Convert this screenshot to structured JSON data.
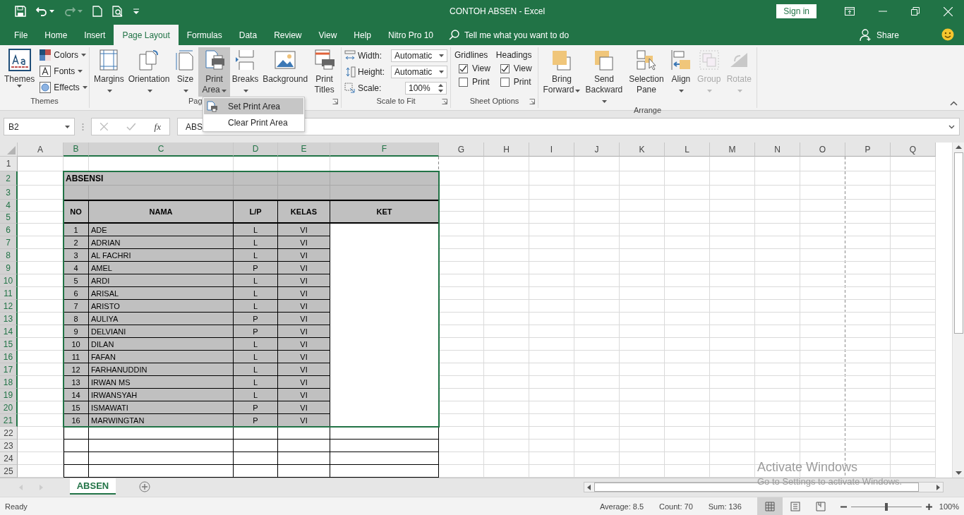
{
  "window": {
    "title": "CONTOH ABSEN  -  Excel",
    "sign_in": "Sign in"
  },
  "menu_tabs": [
    {
      "label": "File",
      "selected": false
    },
    {
      "label": "Home",
      "selected": false
    },
    {
      "label": "Insert",
      "selected": false
    },
    {
      "label": "Page Layout",
      "selected": true
    },
    {
      "label": "Formulas",
      "selected": false
    },
    {
      "label": "Data",
      "selected": false
    },
    {
      "label": "Review",
      "selected": false
    },
    {
      "label": "View",
      "selected": false
    },
    {
      "label": "Help",
      "selected": false
    },
    {
      "label": "Nitro Pro 10",
      "selected": false
    }
  ],
  "tell_me": "Tell me what you want to do",
  "share": "Share",
  "ribbon": {
    "themes": {
      "label": "Themes",
      "big": {
        "label": "Themes",
        "dropdown": true
      },
      "items": [
        {
          "label": "Colors"
        },
        {
          "label": "Fonts"
        },
        {
          "label": "Effects"
        }
      ]
    },
    "page_setup": {
      "label": "Pag",
      "buttons": [
        {
          "label": "Margins",
          "dropdown": true,
          "selected": false
        },
        {
          "label": "Orientation",
          "dropdown": true,
          "selected": false
        },
        {
          "label": "Size",
          "dropdown": true,
          "selected": false
        },
        {
          "label": "Print Area",
          "dropdown": true,
          "selected": true
        },
        {
          "label": "Breaks",
          "dropdown": true,
          "selected": false
        },
        {
          "label": "Background",
          "dropdown": false,
          "selected": false
        },
        {
          "label": "Print Titles",
          "dropdown": false,
          "selected": false
        }
      ]
    },
    "scale_to_fit": {
      "label": "Scale to Fit",
      "fields": [
        {
          "label": "Width:",
          "value": "Automatic",
          "kind": "dropdown"
        },
        {
          "label": "Height:",
          "value": "Automatic",
          "kind": "dropdown"
        },
        {
          "label": "Scale:",
          "value": "100%",
          "kind": "spinner"
        }
      ]
    },
    "sheet_options": {
      "label": "Sheet Options",
      "columns": [
        {
          "heading": "Gridlines",
          "options": [
            {
              "label": "View",
              "checked": true
            },
            {
              "label": "Print",
              "checked": false
            }
          ]
        },
        {
          "heading": "Headings",
          "options": [
            {
              "label": "View",
              "checked": true
            },
            {
              "label": "Print",
              "checked": false
            }
          ]
        }
      ]
    },
    "arrange": {
      "label": "Arrange",
      "buttons": [
        {
          "label": "Bring Forward",
          "dropdown": true,
          "disabled": false
        },
        {
          "label": "Send Backward",
          "dropdown": true,
          "disabled": false
        },
        {
          "label": "Selection Pane",
          "dropdown": false,
          "disabled": false
        },
        {
          "label": "Align",
          "dropdown": true,
          "disabled": false
        },
        {
          "label": "Group",
          "dropdown": true,
          "disabled": true
        },
        {
          "label": "Rotate",
          "dropdown": true,
          "disabled": true
        }
      ]
    }
  },
  "print_area_menu": [
    {
      "label": "Set Print Area",
      "selected": true
    },
    {
      "label": "Clear Print Area",
      "selected": false
    }
  ],
  "name_box": "B2",
  "function_button": "fx",
  "formula": "ABS",
  "columns": [
    {
      "label": "A",
      "selected": false
    },
    {
      "label": "B",
      "selected": true
    },
    {
      "label": "C",
      "selected": true
    },
    {
      "label": "D",
      "selected": true
    },
    {
      "label": "E",
      "selected": true
    },
    {
      "label": "F",
      "selected": true
    },
    {
      "label": "G",
      "selected": false
    },
    {
      "label": "H",
      "selected": false
    },
    {
      "label": "I",
      "selected": false
    },
    {
      "label": "J",
      "selected": false
    },
    {
      "label": "K",
      "selected": false
    },
    {
      "label": "L",
      "selected": false
    },
    {
      "label": "M",
      "selected": false
    },
    {
      "label": "N",
      "selected": false
    },
    {
      "label": "O",
      "selected": false
    },
    {
      "label": "P",
      "selected": false
    },
    {
      "label": "Q",
      "selected": false
    }
  ],
  "rows": [
    {
      "label": "1",
      "selected": false
    },
    {
      "label": "2",
      "selected": true
    },
    {
      "label": "3",
      "selected": true
    },
    {
      "label": "4",
      "selected": true
    },
    {
      "label": "5",
      "selected": true
    },
    {
      "label": "6",
      "selected": true
    },
    {
      "label": "7",
      "selected": true
    },
    {
      "label": "8",
      "selected": true
    },
    {
      "label": "9",
      "selected": true
    },
    {
      "label": "10",
      "selected": true
    },
    {
      "label": "11",
      "selected": true
    },
    {
      "label": "12",
      "selected": true
    },
    {
      "label": "13",
      "selected": true
    },
    {
      "label": "14",
      "selected": true
    },
    {
      "label": "15",
      "selected": true
    },
    {
      "label": "16",
      "selected": true
    },
    {
      "label": "17",
      "selected": true
    },
    {
      "label": "18",
      "selected": true
    },
    {
      "label": "19",
      "selected": true
    },
    {
      "label": "20",
      "selected": true
    },
    {
      "label": "21",
      "selected": true
    },
    {
      "label": "22",
      "selected": false
    },
    {
      "label": "23",
      "selected": false
    },
    {
      "label": "24",
      "selected": false
    },
    {
      "label": "25",
      "selected": false
    }
  ],
  "table": {
    "title": "ABSENSI",
    "headers": [
      "NO",
      "NAMA",
      "L/P",
      "KELAS",
      "KET"
    ],
    "records": [
      {
        "no": "1",
        "name": "ADE",
        "gender": "L",
        "class": "VI"
      },
      {
        "no": "2",
        "name": "ADRIAN",
        "gender": "L",
        "class": "VI"
      },
      {
        "no": "3",
        "name": "AL FACHRI",
        "gender": "L",
        "class": "VI"
      },
      {
        "no": "4",
        "name": "AMEL",
        "gender": "P",
        "class": "VI"
      },
      {
        "no": "5",
        "name": "ARDI",
        "gender": "L",
        "class": "VI"
      },
      {
        "no": "6",
        "name": "ARISAL",
        "gender": "L",
        "class": "VI"
      },
      {
        "no": "7",
        "name": "ARISTO",
        "gender": "L",
        "class": "VI"
      },
      {
        "no": "8",
        "name": "AULIYA",
        "gender": "P",
        "class": "VI"
      },
      {
        "no": "9",
        "name": "DELVIANI",
        "gender": "P",
        "class": "VI"
      },
      {
        "no": "10",
        "name": "DILAN",
        "gender": "L",
        "class": "VI"
      },
      {
        "no": "11",
        "name": "FAFAN",
        "gender": "L",
        "class": "VI"
      },
      {
        "no": "12",
        "name": "FARHANUDDIN",
        "gender": "L",
        "class": "VI"
      },
      {
        "no": "13",
        "name": "IRWAN MS",
        "gender": "L",
        "class": "VI"
      },
      {
        "no": "14",
        "name": "IRWANSYAH",
        "gender": "L",
        "class": "VI"
      },
      {
        "no": "15",
        "name": "ISMAWATI",
        "gender": "P",
        "class": "VI"
      },
      {
        "no": "16",
        "name": "MARWINGTAN",
        "gender": "P",
        "class": "VI"
      }
    ]
  },
  "sheet_tabs": [
    {
      "label": "ABSEN",
      "selected": true
    }
  ],
  "status_bar": {
    "ready": "Ready",
    "average": "Average: 8.5",
    "count": "Count: 70",
    "sum": "Sum: 136",
    "views": [
      {
        "selected": true
      },
      {
        "selected": false
      },
      {
        "selected": false
      }
    ],
    "level": 0.5,
    "zoom": "100%"
  },
  "activate_windows": {
    "title": "Activate Windows",
    "subtitle": "Go to Settings to activate Windows."
  }
}
